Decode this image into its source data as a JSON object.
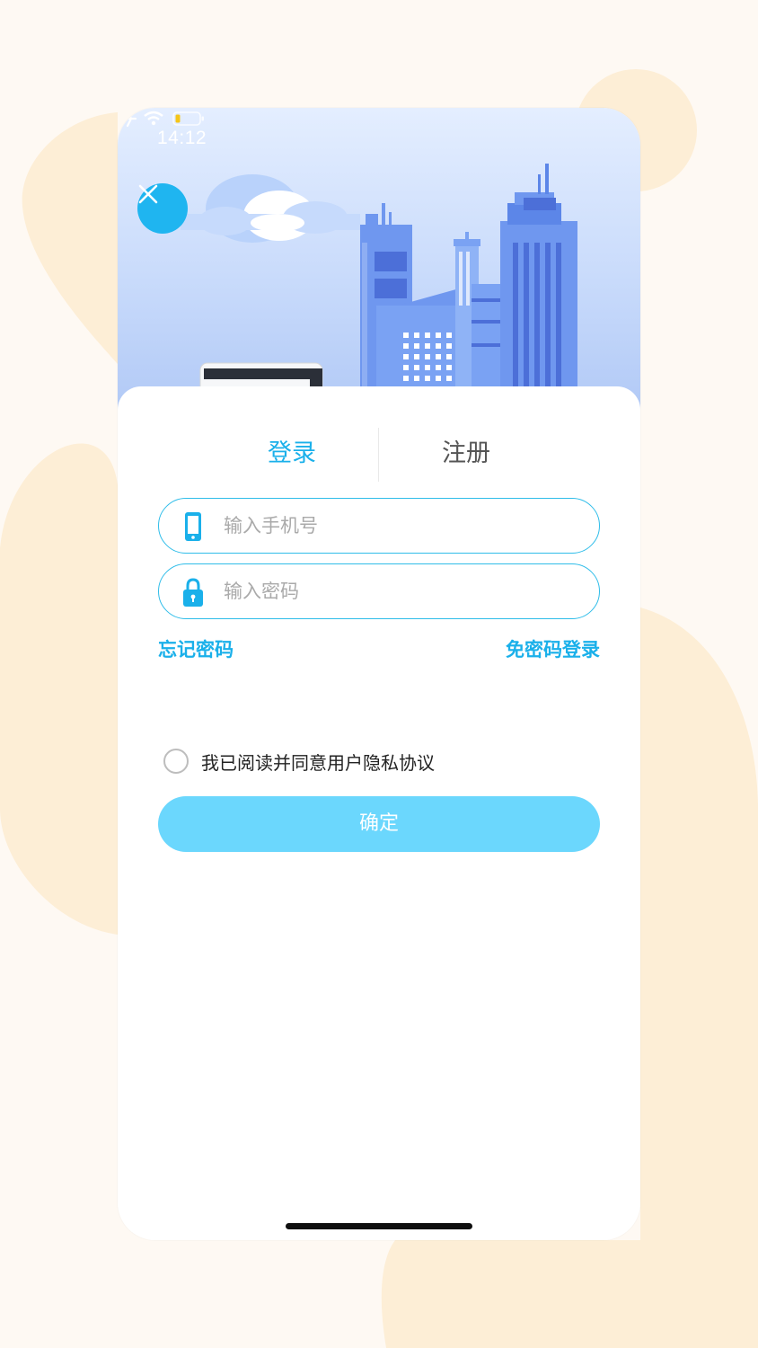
{
  "status_bar": {
    "time": "14:12",
    "icons": [
      "airplane-icon",
      "wifi-icon",
      "battery-icon"
    ]
  },
  "header": {
    "close_icon": "close-icon"
  },
  "tabs": [
    {
      "label": "登录",
      "active": true
    },
    {
      "label": "注册",
      "active": false
    }
  ],
  "form": {
    "phone": {
      "icon": "phone-icon",
      "placeholder": "输入手机号",
      "value": ""
    },
    "password": {
      "icon": "lock-icon",
      "placeholder": "输入密码",
      "value": ""
    },
    "forgot_label": "忘记密码",
    "no_password_login_label": "免密码登录",
    "agreement_label": "我已阅读并同意用户隐私协议",
    "agreement_checked": false,
    "confirm_label": "确定"
  },
  "colors": {
    "accent": "#1ab0ea",
    "button_disabled": "#6bd7fd",
    "background": "#fef9f3",
    "blob": "#fdeed6"
  }
}
